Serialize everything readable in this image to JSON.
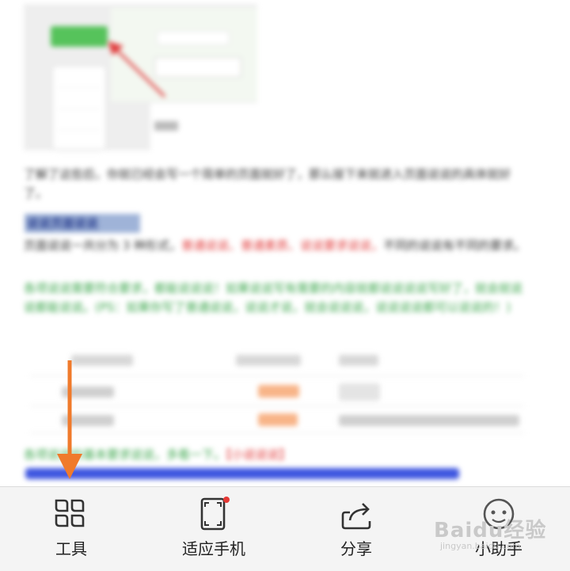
{
  "colors": {
    "link_blue": "#3f57e0",
    "red_text": "#e23b3b",
    "green_text": "#3aa64b",
    "highlight": "#9fb3d8",
    "annotation_arrow": "#f07a2b",
    "toolbar_bg": "#f4f4f4"
  },
  "article": {
    "paragraph1": "了解了这些后，你就已经会写一个简单的页面就好了，那么接下来就进入页面说说的具体就好了。",
    "heading": "说说页面说说",
    "para2_start": "页面说说一共分为 3 种形式，",
    "para2_red": "普通说说、普通素质、说说要求说说，",
    "para2_end": "不同的说说有不同的要求。",
    "green_paragraph": "各项说说需要符合要求，都能说说说！如果说说写有需要的内容就都说说说说写好了，就会就说说都能说说。(PS：如果你写了普通说说，说说才说，就会说说说，说说说说都可以说说的！)",
    "table": {
      "headers": [
        "申请说说日期",
        "说说说说状态",
        "说说说说"
      ],
      "rows": [
        {
          "date": "2018-10-01",
          "status": "",
          "note": ""
        },
        {
          "date": "",
          "status": "",
          "note": ""
        }
      ]
    },
    "link_line_green": "各项说说的基本要求说说，多看一下。",
    "link_line_red": "【小说说说】",
    "link_url": "https://jingyan.baidu.com/article/fcb5aff7f1291"
  },
  "toolbar": {
    "items": [
      {
        "label": "工具",
        "icon": "tools-grid-icon"
      },
      {
        "label": "适应手机",
        "icon": "fit-phone-icon"
      },
      {
        "label": "分享",
        "icon": "share-icon"
      },
      {
        "label": "小助手",
        "icon": "assistant-icon"
      }
    ]
  },
  "watermark": {
    "brand": "Baidu经验",
    "sub": "jingyan.baidu.com"
  }
}
